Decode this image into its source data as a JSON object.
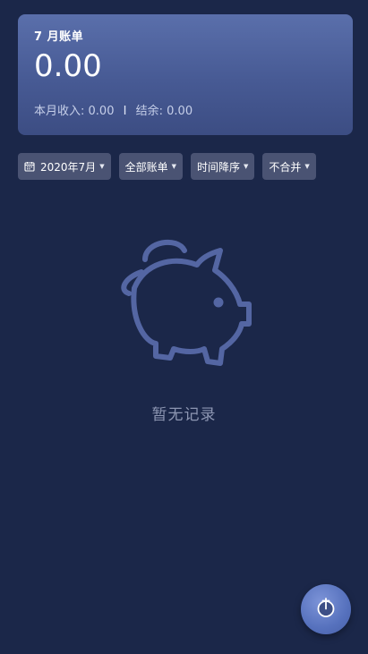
{
  "summary": {
    "title": "7 月账单",
    "amount": "0.00",
    "income_label": "本月收入:",
    "income_value": "0.00",
    "balance_label": "结余:",
    "balance_value": "0.00",
    "separator": "I"
  },
  "filters": [
    {
      "label": "2020年7月",
      "icon": "calendar-icon"
    },
    {
      "label": "全部账单"
    },
    {
      "label": "时间降序"
    },
    {
      "label": "不合并"
    }
  ],
  "empty_state": {
    "icon": "piggy-bank-icon",
    "text": "暂无记录"
  },
  "fab": {
    "icon": "stopwatch-add-icon"
  },
  "colors": {
    "background": "#1b2749",
    "card": "#4d62a0",
    "chip": "#4a5373",
    "icon": "#5466a3",
    "fab": "#5671bd"
  }
}
